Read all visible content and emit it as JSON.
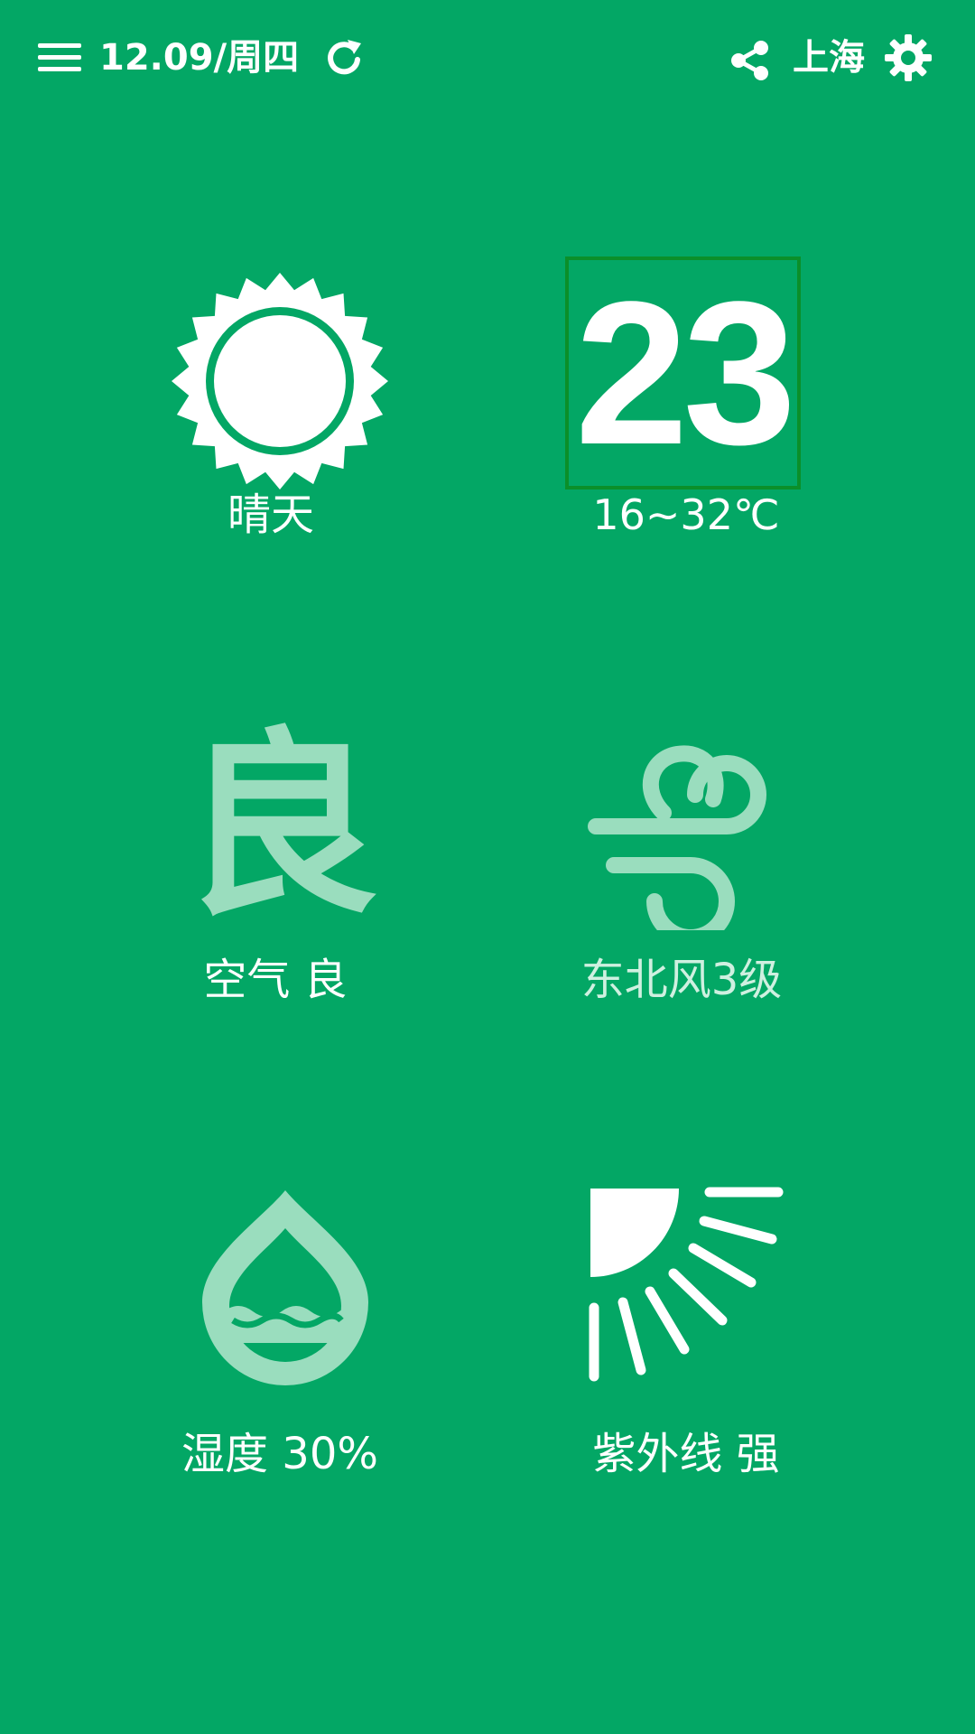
{
  "header": {
    "date": "12.09/周四",
    "city": "上海",
    "icons": {
      "menu": "menu-icon",
      "refresh": "refresh-icon",
      "share": "share-icon",
      "settings": "gear-icon"
    }
  },
  "weather": {
    "condition": "晴天",
    "temperature": "23",
    "temp_range": "16~32℃",
    "air_quality_glyph": "良",
    "air_quality_label": "空气 良",
    "wind_label": "东北风3级",
    "humidity_label": "湿度 30%",
    "uv_label": "紫外线 强"
  },
  "colors": {
    "background": "#03A765",
    "temp_box_border": "#0B8F2A",
    "icon_light": "#9ADDBE",
    "text": "#FFFFFF"
  }
}
